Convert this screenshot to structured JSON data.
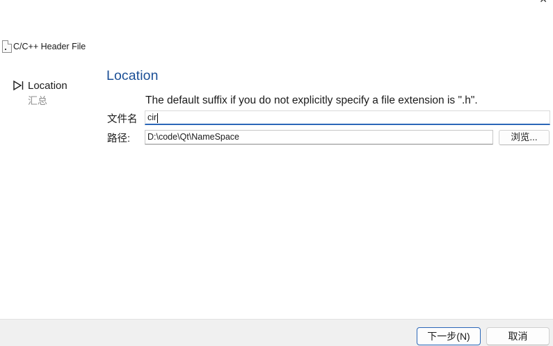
{
  "window": {
    "close_glyph": "✕"
  },
  "header": {
    "icon": "file-icon",
    "title": "C/C++ Header File"
  },
  "steps": {
    "active": {
      "icon": "step-arrow-icon",
      "label": "Location"
    },
    "next": {
      "label": "汇总"
    }
  },
  "page": {
    "title": "Location",
    "hint": "The default suffix if you do not explicitly specify a file extension is \".h\"."
  },
  "form": {
    "name_label": "文件名",
    "name_value": "cir",
    "path_label": "路径:",
    "path_value": "D:\\code\\Qt\\NameSpace",
    "browse_label": "浏览..."
  },
  "footer": {
    "next_label": "下一步(N)",
    "cancel_label": "取消"
  },
  "colors": {
    "accent": "#2a66b8",
    "title": "#1b4f96",
    "footer_bg": "#f0f0f0"
  }
}
